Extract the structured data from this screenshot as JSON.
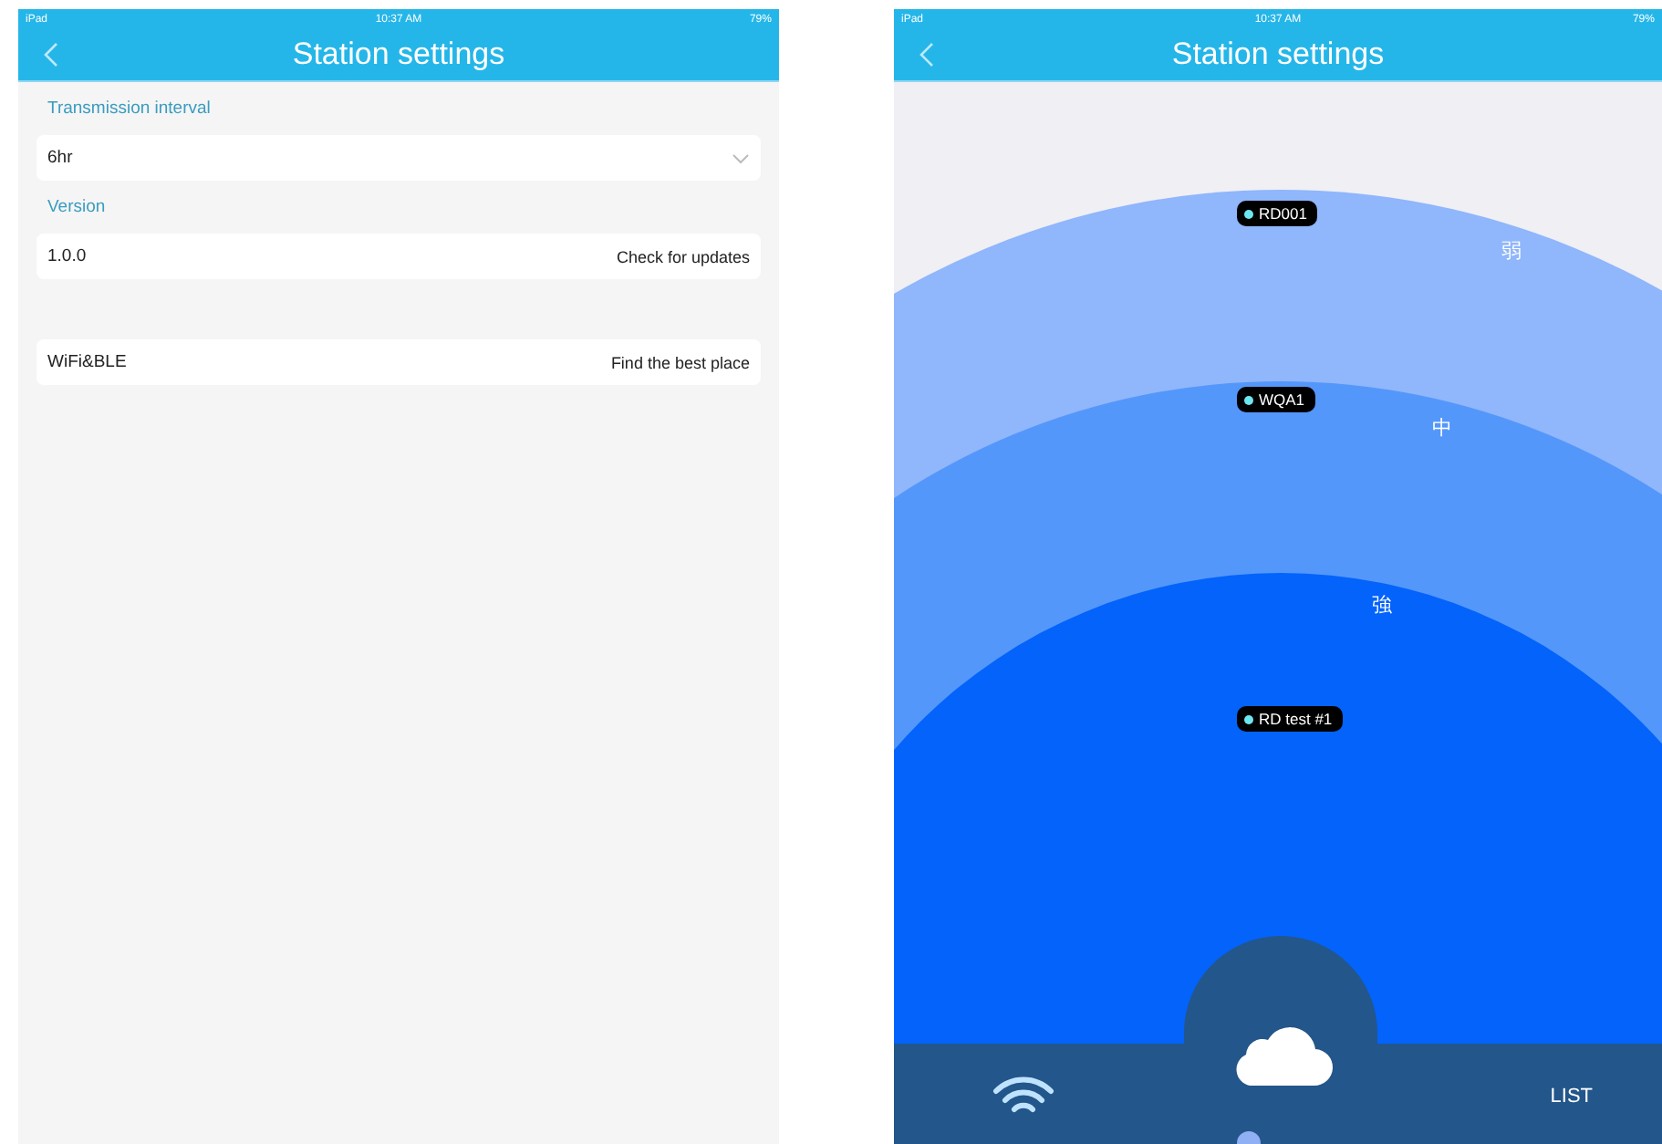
{
  "settings_screen": {
    "status_bar": {
      "device": "iPad",
      "time": "10:37 AM",
      "battery": "79%"
    },
    "title": "Station settings",
    "sections": [
      {
        "kind": "dropdown",
        "label": "Transmission interval",
        "value": "6hr"
      },
      {
        "kind": "action",
        "label": "Version",
        "value": "1.0.0",
        "action": "Check for updates"
      },
      {
        "kind": "action",
        "value": "WiFi&BLE",
        "action": "Find the best place"
      }
    ]
  },
  "radar_screen": {
    "status_bar": {
      "device": "iPad",
      "time": "10:37 AM",
      "battery": "79%"
    },
    "title": "Station settings",
    "zones": [
      {
        "label": "弱",
        "stations": [
          "RD001"
        ]
      },
      {
        "label": "中",
        "stations": [
          "WQA1"
        ]
      },
      {
        "label": "強",
        "stations": [
          "RD test #1"
        ]
      }
    ],
    "list_button": "LIST"
  }
}
